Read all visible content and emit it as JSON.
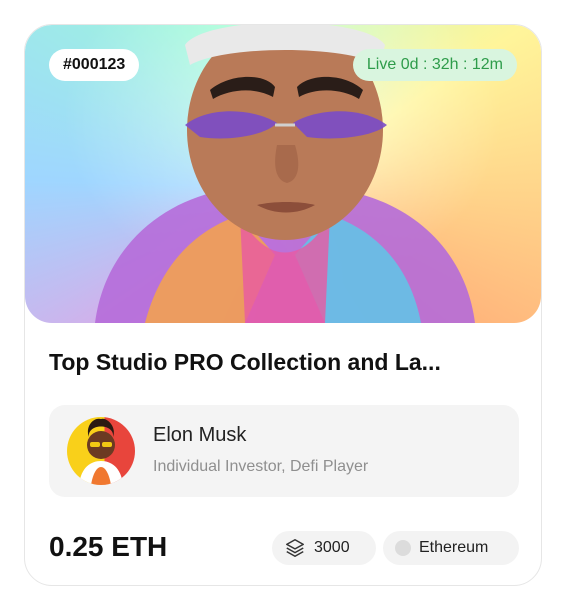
{
  "card": {
    "token_id": "#000123",
    "live_timer": "Live 0d : 32h : 12m",
    "title": "Top Studio PRO Collection and La...",
    "owner": {
      "name": "Elon Musk",
      "role": "Individual Investor, Defi Player"
    },
    "price": "0.25 ETH",
    "edition_count": "3000",
    "chain": "Ethereum"
  },
  "icons": {
    "edition": "layers-icon",
    "chain": "chain-dot-icon"
  },
  "colors": {
    "live_bg": "#d9f5df",
    "live_text": "#2e9c4a",
    "pill_bg": "#f3f3f3",
    "owner_bg": "#f4f4f4"
  }
}
